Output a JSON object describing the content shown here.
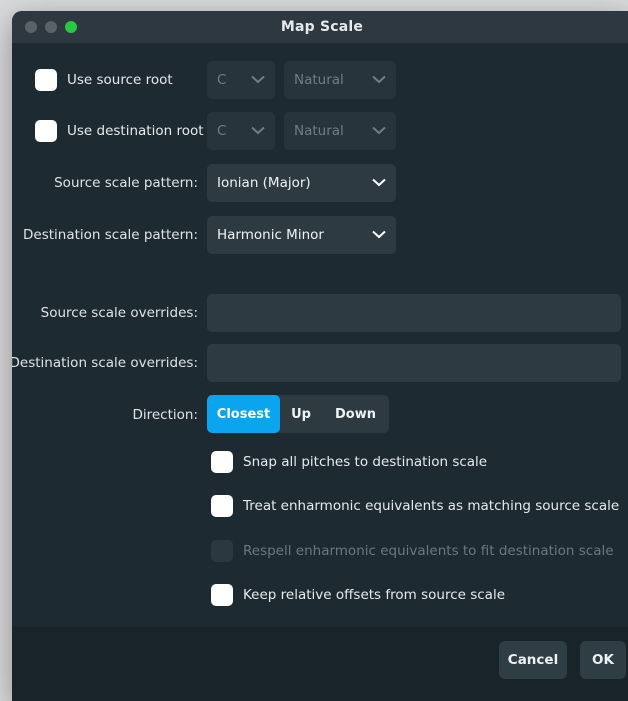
{
  "window": {
    "title": "Map Scale"
  },
  "roots": {
    "source": {
      "label": "Use source root",
      "note": "C",
      "accidental": "Natural"
    },
    "destination": {
      "label": "Use destination root",
      "note": "C",
      "accidental": "Natural"
    }
  },
  "patterns": {
    "source_label": "Source scale pattern:",
    "source_value": "Ionian (Major)",
    "destination_label": "Destination scale pattern:",
    "destination_value": "Harmonic Minor"
  },
  "overrides": {
    "source_label": "Source scale overrides:",
    "source_value": "",
    "destination_label": "Destination scale overrides:",
    "destination_value": ""
  },
  "direction": {
    "label": "Direction:",
    "options": [
      "Closest",
      "Up",
      "Down"
    ],
    "selected": "Closest"
  },
  "options": {
    "snap": "Snap all pitches to destination scale",
    "enharmonic": "Treat enharmonic equivalents as matching source scale",
    "respell": "Respell enharmonic equivalents to fit destination scale",
    "keep_offsets": "Keep relative offsets from source scale"
  },
  "footer": {
    "cancel": "Cancel",
    "ok": "OK"
  },
  "colors": {
    "accent": "#0aa5ee",
    "window_bg": "#1e2a32",
    "control_bg": "#2d3a42"
  },
  "icons": [
    "chevron-down-icon"
  ]
}
